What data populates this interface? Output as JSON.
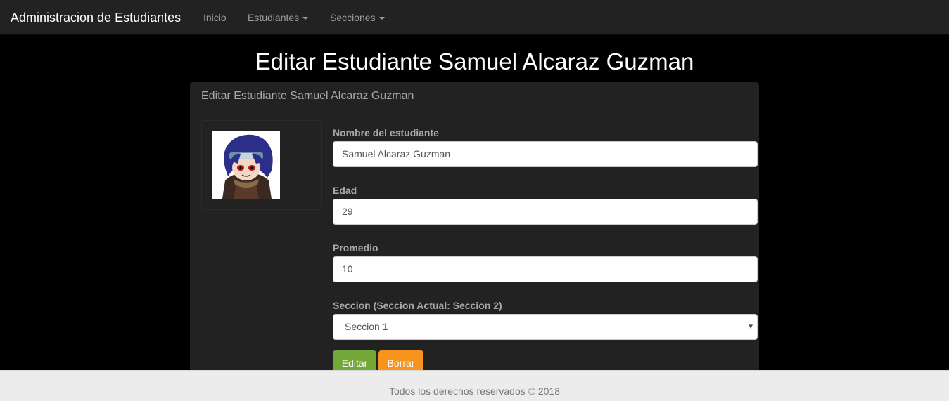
{
  "navbar": {
    "brand": "Administracion de Estudiantes",
    "items": [
      {
        "label": "Inicio",
        "dropdown": false
      },
      {
        "label": "Estudiantes",
        "dropdown": true
      },
      {
        "label": "Secciones",
        "dropdown": true
      }
    ]
  },
  "page": {
    "title": "Editar Estudiante Samuel Alcaraz Guzman"
  },
  "panel": {
    "heading": "Editar Estudiante Samuel Alcaraz Guzman",
    "avatar_icon": "student-avatar-image"
  },
  "form": {
    "name_label": "Nombre del estudiante",
    "name_value": "Samuel Alcaraz Guzman",
    "age_label": "Edad",
    "age_value": "29",
    "average_label": "Promedio",
    "average_value": "10",
    "section_label": "Seccion (Seccion Actual: Seccion 2)",
    "section_selected": "Seccion 1",
    "edit_button": "Editar",
    "delete_button": "Borrar"
  },
  "colors": {
    "navbar_bg": "#222222",
    "page_bg": "#000000",
    "edit_button": "#73a839",
    "delete_button": "#f7941d",
    "footer_bg": "#ececec"
  },
  "footer": {
    "text": "Todos los derechos reservados © 2018"
  }
}
